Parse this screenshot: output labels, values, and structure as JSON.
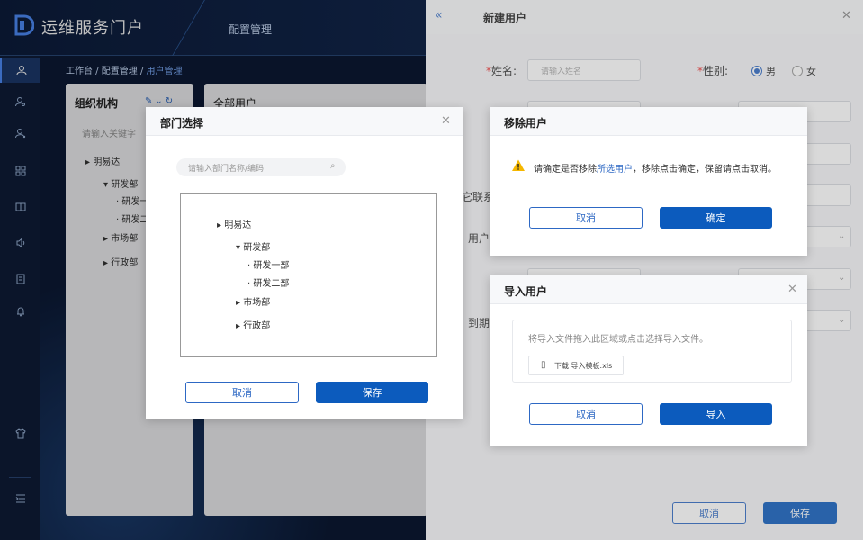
{
  "app": {
    "title": "运维服务门户",
    "nav_tab": "配置管理"
  },
  "breadcrumb": [
    "工作台",
    "配置管理",
    "用户管理"
  ],
  "org": {
    "title": "组织机构",
    "search_placeholder": "请输入关键字",
    "tree": {
      "root": "明易达",
      "dev": "研发部",
      "dev1": "研发一",
      "dev2": "研发二",
      "market": "市场部",
      "admin": "行政部"
    }
  },
  "users": {
    "title": "全部用户"
  },
  "drawer": {
    "title": "新建用户",
    "name_label": "姓名:",
    "name_placeholder": "请输入姓名",
    "gender_label": "性别:",
    "gender_male": "男",
    "gender_female": "女",
    "partial_labels": {
      "contact": "它联系",
      "user": "用户",
      "expire": "到期"
    },
    "cancel": "取消",
    "save": "保存"
  },
  "dept_modal": {
    "title": "部门选择",
    "search_placeholder": "请输入部门名称/编码",
    "tree": {
      "root": "明易达",
      "dev": "研发部",
      "dev1": "研发一部",
      "dev2": "研发二部",
      "market": "市场部",
      "admin": "行政部"
    },
    "cancel": "取消",
    "save": "保存"
  },
  "remove_modal": {
    "title": "移除用户",
    "msg_before": "请确定是否移除",
    "msg_link": "所选用户",
    "msg_after": "，移除点击确定，保留请点击取消。",
    "cancel": "取消",
    "confirm": "确定"
  },
  "import_modal": {
    "title": "导入用户",
    "drop_text": "将导入文件拖入此区域或点击选择导入文件。",
    "template_link": "下载 导入模板.xls",
    "cancel": "取消",
    "import": "导入"
  },
  "colors": {
    "primary": "#0c5bbd",
    "dark_bg": "#0b1730",
    "warning": "#f5b700"
  }
}
